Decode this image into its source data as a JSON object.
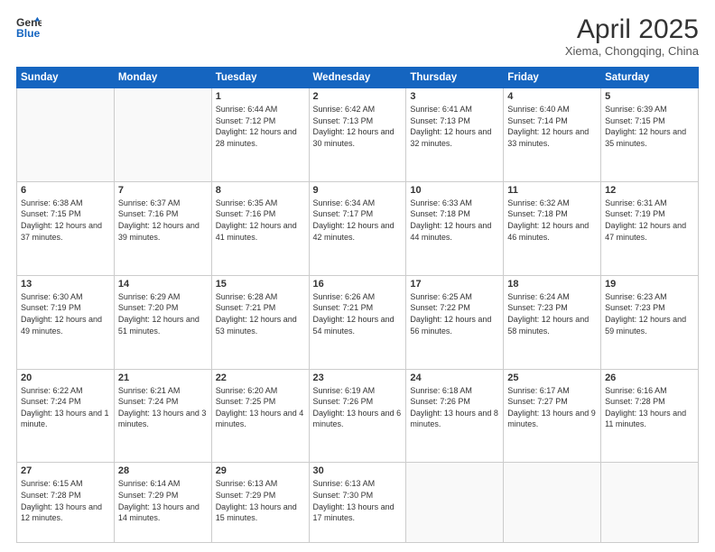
{
  "logo": {
    "general": "General",
    "blue": "Blue"
  },
  "header": {
    "title": "April 2025",
    "subtitle": "Xiema, Chongqing, China"
  },
  "weekdays": [
    "Sunday",
    "Monday",
    "Tuesday",
    "Wednesday",
    "Thursday",
    "Friday",
    "Saturday"
  ],
  "days": [
    {
      "date": "",
      "info": ""
    },
    {
      "date": "",
      "info": ""
    },
    {
      "date": "1",
      "info": "Sunrise: 6:44 AM\nSunset: 7:12 PM\nDaylight: 12 hours and 28 minutes."
    },
    {
      "date": "2",
      "info": "Sunrise: 6:42 AM\nSunset: 7:13 PM\nDaylight: 12 hours and 30 minutes."
    },
    {
      "date": "3",
      "info": "Sunrise: 6:41 AM\nSunset: 7:13 PM\nDaylight: 12 hours and 32 minutes."
    },
    {
      "date": "4",
      "info": "Sunrise: 6:40 AM\nSunset: 7:14 PM\nDaylight: 12 hours and 33 minutes."
    },
    {
      "date": "5",
      "info": "Sunrise: 6:39 AM\nSunset: 7:15 PM\nDaylight: 12 hours and 35 minutes."
    },
    {
      "date": "6",
      "info": "Sunrise: 6:38 AM\nSunset: 7:15 PM\nDaylight: 12 hours and 37 minutes."
    },
    {
      "date": "7",
      "info": "Sunrise: 6:37 AM\nSunset: 7:16 PM\nDaylight: 12 hours and 39 minutes."
    },
    {
      "date": "8",
      "info": "Sunrise: 6:35 AM\nSunset: 7:16 PM\nDaylight: 12 hours and 41 minutes."
    },
    {
      "date": "9",
      "info": "Sunrise: 6:34 AM\nSunset: 7:17 PM\nDaylight: 12 hours and 42 minutes."
    },
    {
      "date": "10",
      "info": "Sunrise: 6:33 AM\nSunset: 7:18 PM\nDaylight: 12 hours and 44 minutes."
    },
    {
      "date": "11",
      "info": "Sunrise: 6:32 AM\nSunset: 7:18 PM\nDaylight: 12 hours and 46 minutes."
    },
    {
      "date": "12",
      "info": "Sunrise: 6:31 AM\nSunset: 7:19 PM\nDaylight: 12 hours and 47 minutes."
    },
    {
      "date": "13",
      "info": "Sunrise: 6:30 AM\nSunset: 7:19 PM\nDaylight: 12 hours and 49 minutes."
    },
    {
      "date": "14",
      "info": "Sunrise: 6:29 AM\nSunset: 7:20 PM\nDaylight: 12 hours and 51 minutes."
    },
    {
      "date": "15",
      "info": "Sunrise: 6:28 AM\nSunset: 7:21 PM\nDaylight: 12 hours and 53 minutes."
    },
    {
      "date": "16",
      "info": "Sunrise: 6:26 AM\nSunset: 7:21 PM\nDaylight: 12 hours and 54 minutes."
    },
    {
      "date": "17",
      "info": "Sunrise: 6:25 AM\nSunset: 7:22 PM\nDaylight: 12 hours and 56 minutes."
    },
    {
      "date": "18",
      "info": "Sunrise: 6:24 AM\nSunset: 7:23 PM\nDaylight: 12 hours and 58 minutes."
    },
    {
      "date": "19",
      "info": "Sunrise: 6:23 AM\nSunset: 7:23 PM\nDaylight: 12 hours and 59 minutes."
    },
    {
      "date": "20",
      "info": "Sunrise: 6:22 AM\nSunset: 7:24 PM\nDaylight: 13 hours and 1 minute."
    },
    {
      "date": "21",
      "info": "Sunrise: 6:21 AM\nSunset: 7:24 PM\nDaylight: 13 hours and 3 minutes."
    },
    {
      "date": "22",
      "info": "Sunrise: 6:20 AM\nSunset: 7:25 PM\nDaylight: 13 hours and 4 minutes."
    },
    {
      "date": "23",
      "info": "Sunrise: 6:19 AM\nSunset: 7:26 PM\nDaylight: 13 hours and 6 minutes."
    },
    {
      "date": "24",
      "info": "Sunrise: 6:18 AM\nSunset: 7:26 PM\nDaylight: 13 hours and 8 minutes."
    },
    {
      "date": "25",
      "info": "Sunrise: 6:17 AM\nSunset: 7:27 PM\nDaylight: 13 hours and 9 minutes."
    },
    {
      "date": "26",
      "info": "Sunrise: 6:16 AM\nSunset: 7:28 PM\nDaylight: 13 hours and 11 minutes."
    },
    {
      "date": "27",
      "info": "Sunrise: 6:15 AM\nSunset: 7:28 PM\nDaylight: 13 hours and 12 minutes."
    },
    {
      "date": "28",
      "info": "Sunrise: 6:14 AM\nSunset: 7:29 PM\nDaylight: 13 hours and 14 minutes."
    },
    {
      "date": "29",
      "info": "Sunrise: 6:13 AM\nSunset: 7:29 PM\nDaylight: 13 hours and 15 minutes."
    },
    {
      "date": "30",
      "info": "Sunrise: 6:13 AM\nSunset: 7:30 PM\nDaylight: 13 hours and 17 minutes."
    },
    {
      "date": "",
      "info": ""
    },
    {
      "date": "",
      "info": ""
    },
    {
      "date": "",
      "info": ""
    }
  ]
}
